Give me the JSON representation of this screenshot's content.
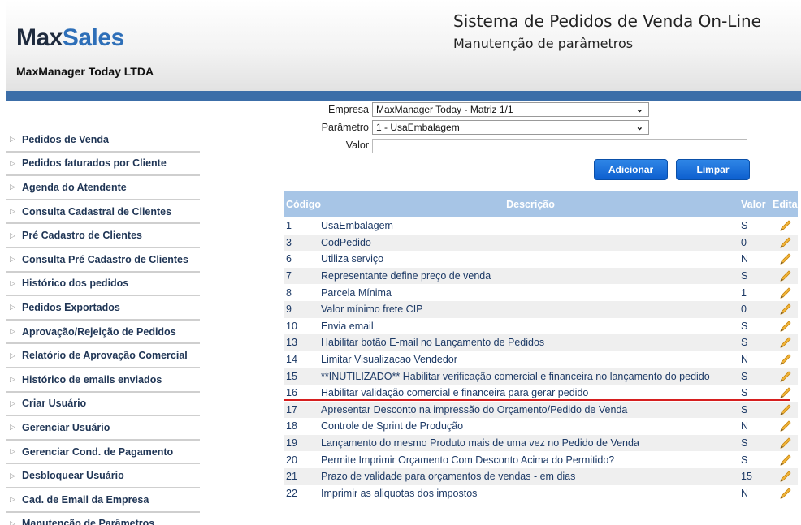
{
  "header": {
    "logo_max": "Max",
    "logo_sales": "Sales",
    "company": "MaxManager Today LTDA",
    "title": "Sistema de Pedidos de Venda On-Line",
    "subtitle": "Manutenção de parâmetros"
  },
  "sidebar": {
    "items": [
      {
        "label": "Pedidos de Venda"
      },
      {
        "label": "Pedidos faturados por Cliente"
      },
      {
        "label": "Agenda do Atendente"
      },
      {
        "label": "Consulta Cadastral de Clientes"
      },
      {
        "label": "Pré Cadastro de Clientes"
      },
      {
        "label": "Consulta Pré Cadastro de Clientes"
      },
      {
        "label": "Histórico dos pedidos"
      },
      {
        "label": "Pedidos Exportados"
      },
      {
        "label": "Aprovação/Rejeição de Pedidos"
      },
      {
        "label": "Relatório de Aprovação Comercial"
      },
      {
        "label": "Histórico de emails enviados"
      },
      {
        "label": "Criar Usuário"
      },
      {
        "label": "Gerenciar Usuário"
      },
      {
        "label": "Gerenciar Cond. de Pagamento"
      },
      {
        "label": "Desbloquear Usuário"
      },
      {
        "label": "Cad. de Email da Empresa"
      },
      {
        "label": "Manutenção de Parâmetros"
      }
    ]
  },
  "form": {
    "empresa_label": "Empresa",
    "empresa_value": "MaxManager Today - Matriz 1/1",
    "parametro_label": "Parâmetro",
    "parametro_value": "1 - UsaEmbalagem",
    "valor_label": "Valor",
    "valor_value": "",
    "add_button": "Adicionar",
    "clear_button": "Limpar"
  },
  "table": {
    "headers": {
      "code": "Código",
      "desc": "Descrição",
      "value": "Valor",
      "edit": "Editar"
    },
    "rows": [
      {
        "code": "1",
        "desc": "UsaEmbalagem",
        "value": "S"
      },
      {
        "code": "3",
        "desc": "CodPedido",
        "value": "0"
      },
      {
        "code": "6",
        "desc": "Utiliza serviço",
        "value": "N"
      },
      {
        "code": "7",
        "desc": "Representante define preço de venda",
        "value": "S"
      },
      {
        "code": "8",
        "desc": "Parcela Mínima",
        "value": "1"
      },
      {
        "code": "9",
        "desc": "Valor mínimo frete CIP",
        "value": "0"
      },
      {
        "code": "10",
        "desc": "Envia email",
        "value": "S"
      },
      {
        "code": "13",
        "desc": "Habilitar botão E-mail no Lançamento de Pedidos",
        "value": "S"
      },
      {
        "code": "14",
        "desc": "Limitar Visualizacao Vendedor",
        "value": "N"
      },
      {
        "code": "15",
        "desc": "**INUTILIZADO** Habilitar verificação comercial e financeira no lançamento do pedido",
        "value": "S"
      },
      {
        "code": "16",
        "desc": "Habilitar validação comercial e financeira para gerar pedido",
        "value": "S"
      },
      {
        "code": "17",
        "desc": "Apresentar Desconto na impressão do Orçamento/Pedido de Venda",
        "value": "S"
      },
      {
        "code": "18",
        "desc": "Controle de Sprint de Produção",
        "value": "N"
      },
      {
        "code": "19",
        "desc": "Lançamento do mesmo Produto mais de uma vez no Pedido de Venda",
        "value": "S"
      },
      {
        "code": "20",
        "desc": "Permite Imprimir Orçamento Com Desconto Acima do Permitido?",
        "value": "S"
      },
      {
        "code": "21",
        "desc": "Prazo de validade para orçamentos de vendas - em dias",
        "value": "15"
      },
      {
        "code": "22",
        "desc": "Imprimir as aliquotas dos impostos",
        "value": "N"
      }
    ]
  },
  "colors": {
    "header_bar": "#3c6ea8",
    "table_header": "#a7c5e6",
    "button": "#1a6fd9",
    "highlight_line": "#d61f1f",
    "pencil": "#e3a21a"
  }
}
